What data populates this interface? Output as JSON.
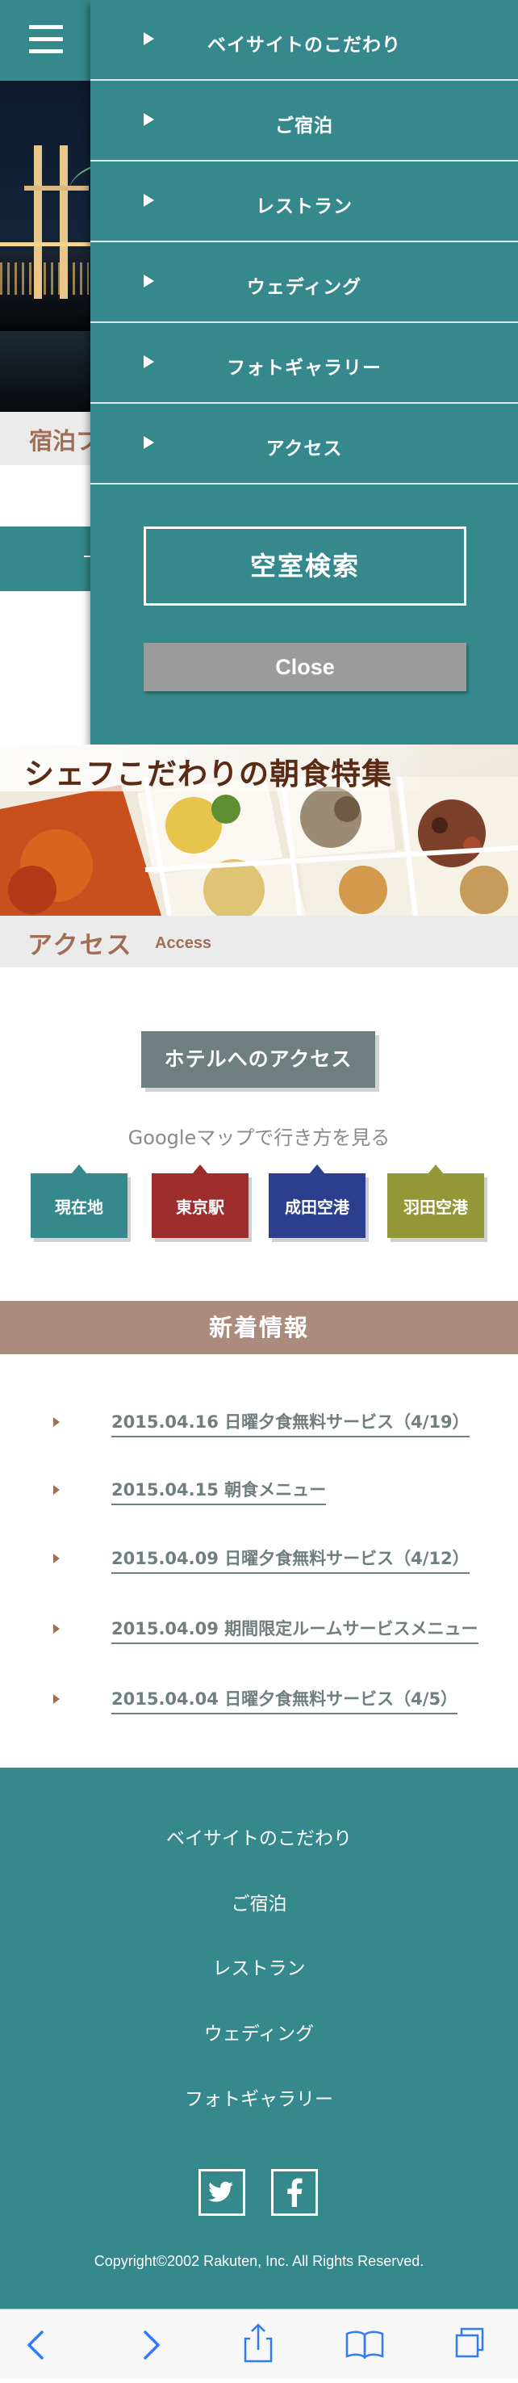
{
  "menu": {
    "items": [
      {
        "label": "ベイサイトのこだわり"
      },
      {
        "label": "ご宿泊"
      },
      {
        "label": "レストラン"
      },
      {
        "label": "ウェディング"
      },
      {
        "label": "フォトギャラリー"
      },
      {
        "label": "アクセス"
      }
    ],
    "search_label": "空室検索",
    "close_label": "Close"
  },
  "background": {
    "section_title": "宿泊プ"
  },
  "banner": {
    "title": "シェフこだわりの朝食特集"
  },
  "access": {
    "title": "アクセス",
    "subtitle": "Access",
    "hotel_access_label": "ホテルへのアクセス",
    "gmap_text": "Googleマップで行き方を見る",
    "routes": [
      {
        "label": "現在地",
        "color": "#35888b"
      },
      {
        "label": "東京駅",
        "color": "#9e2e2e"
      },
      {
        "label": "成田空港",
        "color": "#2c3e8e"
      },
      {
        "label": "羽田空港",
        "color": "#949738"
      }
    ]
  },
  "news": {
    "title": "新着情報",
    "items": [
      {
        "text": "2015.04.16 日曜夕食無料サービス（4/19）"
      },
      {
        "text": "2015.04.15 朝食メニュー"
      },
      {
        "text": "2015.04.09 日曜夕食無料サービス（4/12）"
      },
      {
        "text": "2015.04.09 期間限定ルームサービスメニュー"
      },
      {
        "text": "2015.04.04 日曜夕食無料サービス（4/5）"
      }
    ]
  },
  "footer": {
    "links": [
      {
        "label": "ベイサイトのこだわり"
      },
      {
        "label": "ご宿泊"
      },
      {
        "label": "レストラン"
      },
      {
        "label": "ウェディング"
      },
      {
        "label": "フォトギャラリー"
      }
    ],
    "social": [
      {
        "icon": "twitter-icon"
      },
      {
        "icon": "facebook-icon"
      }
    ],
    "copyright": "Copyright©2002 Rakuten, Inc. All Rights Reserved."
  },
  "browser_toolbar": {
    "icons": [
      "back-icon",
      "forward-icon",
      "share-icon",
      "bookmarks-icon",
      "tabs-icon"
    ],
    "accent": "#2f7cf6"
  },
  "theme": {
    "teal": "#35888b",
    "brown": "#a06e55",
    "news_head": "#ab8b7c"
  }
}
